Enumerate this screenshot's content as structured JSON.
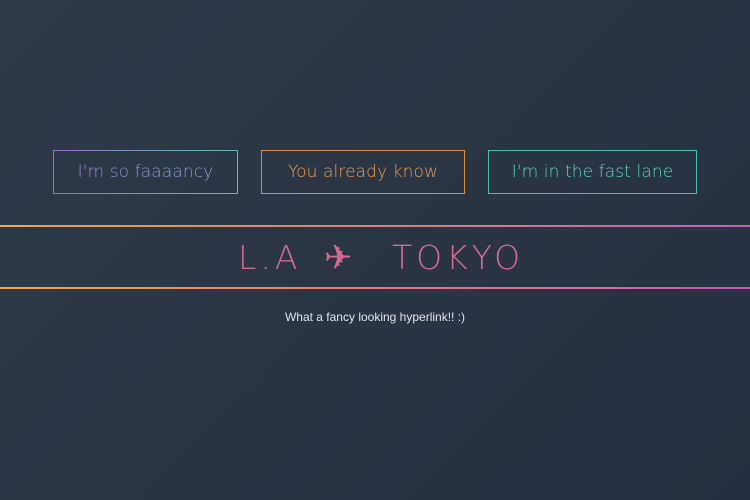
{
  "buttons": {
    "fancy_label": "I'm so faaaancy",
    "know_label": "You already know",
    "fast_label": "I'm in the fast lane"
  },
  "route": {
    "from": "L.A",
    "plane_icon": "airplane-icon",
    "plane_glyph": "✈",
    "to": "TOKYO"
  },
  "link": {
    "text": "What a fancy looking hyperlink!! :)"
  },
  "colors": {
    "background": "#2b3645",
    "orange": "#e08a3e",
    "teal": "#3fbfa6",
    "purple": "#9a6fcf",
    "pink": "#d06a8f"
  }
}
